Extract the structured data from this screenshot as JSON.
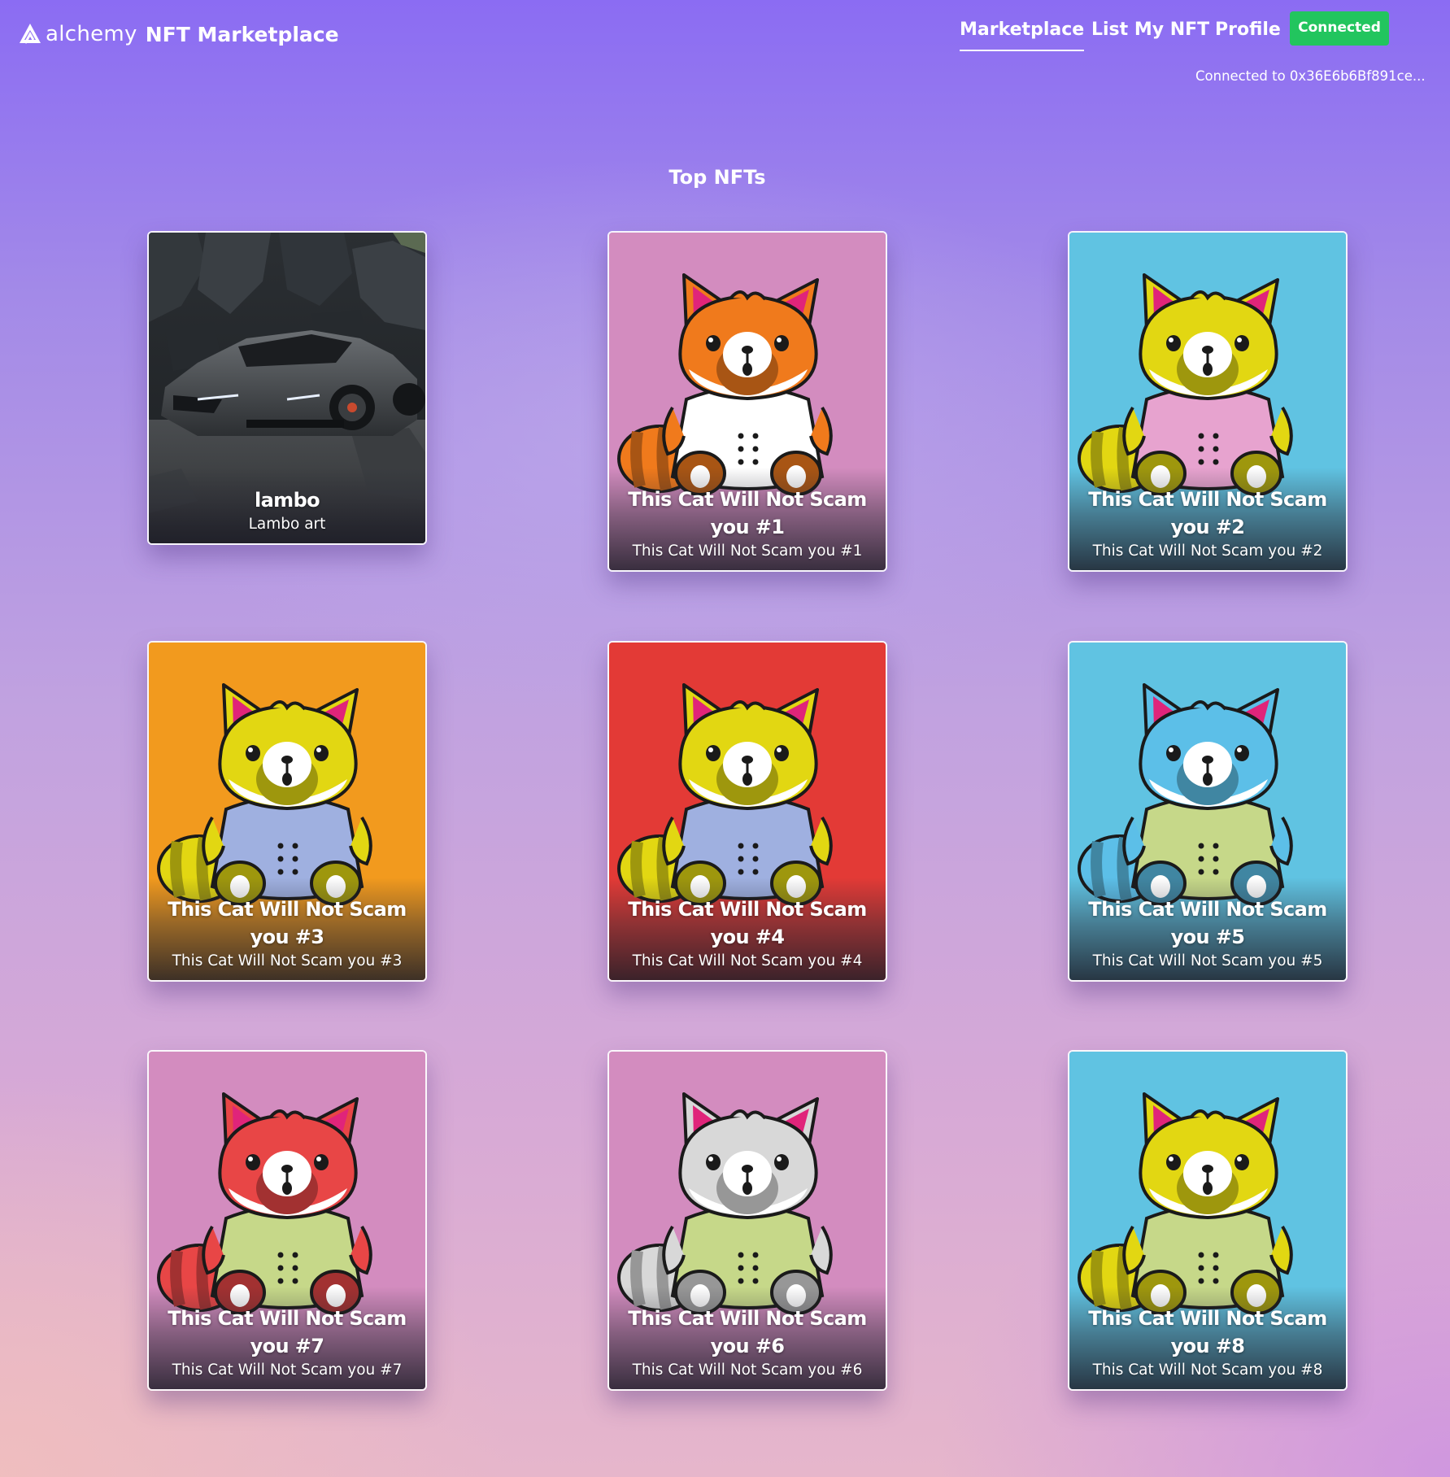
{
  "header": {
    "logo_word": "alchemy",
    "app_title": "NFT Marketplace",
    "nav": [
      {
        "label": "Marketplace",
        "active": true
      },
      {
        "label": "List My NFT",
        "active": false
      },
      {
        "label": "Profile",
        "active": false
      }
    ],
    "connect_button_label": "Connected",
    "connection_status": "Connected to 0x36E6b6Bf891ce..."
  },
  "main": {
    "section_title": "Top NFTs",
    "nfts": [
      {
        "title": "lambo",
        "description": "Lambo art",
        "art": "car-photo"
      },
      {
        "title": "This Cat Will Not Scam you #1",
        "description": "This Cat Will Not Scam you #1",
        "art": "cat",
        "background": "#d38cbf",
        "fur": "#f07a1c",
        "shirt": "#ffffff"
      },
      {
        "title": "This Cat Will Not Scam you #2",
        "description": "This Cat Will Not Scam you #2",
        "art": "cat",
        "background": "#60c3e2",
        "fur": "#e2d712",
        "shirt": "#e7a3cf"
      },
      {
        "title": "This Cat Will Not Scam you #3",
        "description": "This Cat Will Not Scam you #3",
        "art": "cat",
        "background": "#f29a1e",
        "fur": "#e2d712",
        "shirt": "#9fb0e0"
      },
      {
        "title": "This Cat Will Not Scam you #4",
        "description": "This Cat Will Not Scam you #4",
        "art": "cat",
        "background": "#e33a36",
        "fur": "#e2d712",
        "shirt": "#9fb0e0"
      },
      {
        "title": "This Cat Will Not Scam you #5",
        "description": "This Cat Will Not Scam you #5",
        "art": "cat",
        "background": "#60c3e2",
        "fur": "#5cbfe8",
        "shirt": "#c6d889"
      },
      {
        "title": "This Cat Will Not Scam you #7",
        "description": "This Cat Will Not Scam you #7",
        "art": "cat",
        "background": "#d38cbf",
        "fur": "#e84646",
        "shirt": "#c6d889"
      },
      {
        "title": "This Cat Will Not Scam you #6",
        "description": "This Cat Will Not Scam you #6",
        "art": "cat",
        "background": "#d38cbf",
        "fur": "#d8d8d8",
        "shirt": "#c6d889"
      },
      {
        "title": "This Cat Will Not Scam you #8",
        "description": "This Cat Will Not Scam you #8",
        "art": "cat",
        "background": "#60c3e2",
        "fur": "#e2d712",
        "shirt": "#c6d889"
      }
    ]
  },
  "colors": {
    "accent_green": "#22c55e",
    "background_top": "#8b6cf3",
    "background_bottom": "#e6b6cb"
  }
}
